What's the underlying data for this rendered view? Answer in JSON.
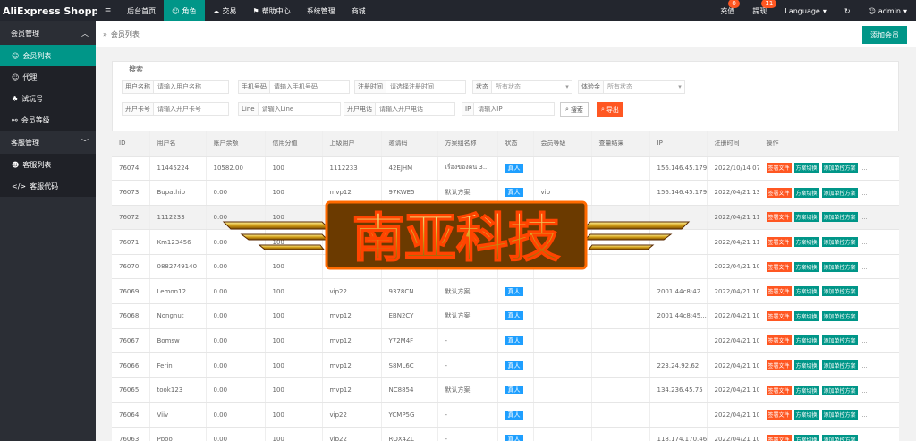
{
  "brand": "AliExpress Shopping...",
  "topnav": [
    {
      "label": "后台首页",
      "icon": "home"
    },
    {
      "label": "角色",
      "icon": "user"
    },
    {
      "label": "交易",
      "icon": "cloud"
    },
    {
      "label": "帮助中心",
      "icon": "flag"
    },
    {
      "label": "系统管理",
      "icon": ""
    },
    {
      "label": "商城",
      "icon": ""
    }
  ],
  "topright": {
    "recharge": "充值",
    "recharge_badge": "0",
    "withdraw": "提现",
    "withdraw_badge": "11",
    "language": "Language",
    "user": "admin"
  },
  "sidebar": {
    "groups": [
      {
        "label": "会员管理",
        "items": [
          {
            "label": "会员列表"
          },
          {
            "label": "代理"
          },
          {
            "label": "试玩号"
          },
          {
            "label": "会员等级"
          }
        ]
      },
      {
        "label": "客服管理",
        "items": [
          {
            "label": "客服列表"
          },
          {
            "label": "客服代码"
          }
        ]
      }
    ]
  },
  "breadcrumb": "会员列表",
  "add_button": "添加会员",
  "search": {
    "title": "搜索",
    "fields": [
      {
        "label": "用户名称",
        "placeholder": "请输入用户名称"
      },
      {
        "label": "手机号码",
        "placeholder": "请输入手机号码"
      },
      {
        "label": "注册时间",
        "placeholder": "请选择注册时间"
      },
      {
        "label": "状态",
        "value": "所有状态"
      },
      {
        "label": "体验金",
        "value": "所有状态"
      },
      {
        "label": "开户卡号",
        "placeholder": "请输入开户卡号"
      },
      {
        "label": "Line",
        "placeholder": "请输入Line"
      },
      {
        "label": "开户电话",
        "placeholder": "请输入开户电话"
      },
      {
        "label": "IP",
        "placeholder": "请输入IP"
      }
    ],
    "search_button": "搜索",
    "export_button": "导出"
  },
  "table": {
    "headers": [
      "ID",
      "用户名",
      "账户余额",
      "信用分值",
      "上级用户",
      "邀请码",
      "方案组名称",
      "状态",
      "会员等级",
      "查量结果",
      "IP",
      "注册时间",
      "操作"
    ],
    "rows": [
      [
        "76074",
        "11445224",
        "10582.00",
        "100",
        "1112233",
        "42EJHM",
        "เรื่องของคน 3...",
        "真人",
        "",
        "",
        "156.146.45.179",
        "2022/10/14 07:45"
      ],
      [
        "76073",
        "Bupathip",
        "0.00",
        "100",
        "mvp12",
        "97KWE5",
        "默认方案",
        "真人",
        "vip",
        "",
        "156.146.45.179",
        "2022/04/21 13:17"
      ],
      [
        "76072",
        "1112233",
        "0.00",
        "100",
        "",
        "",
        "",
        "",
        "",
        "",
        "",
        "2022/04/21 11:10"
      ],
      [
        "76071",
        "Km123456",
        "0.00",
        "100",
        "",
        "",
        "",
        "",
        "",
        "",
        "",
        "2022/04/21 11:01"
      ],
      [
        "76070",
        "0882749140",
        "0.00",
        "100",
        "vip22",
        "TOCKUV",
        "",
        "",
        "",
        "",
        "",
        "2022/04/21 10:58"
      ],
      [
        "76069",
        "Lemon12",
        "0.00",
        "100",
        "vip22",
        "9378CN",
        "默认方案",
        "真人",
        "",
        "",
        "2001:44c8:42...",
        "2022/04/21 10:53"
      ],
      [
        "76068",
        "Nongnut",
        "0.00",
        "100",
        "mvp12",
        "EBN2CY",
        "默认方案",
        "真人",
        "",
        "",
        "2001:44c8:45...",
        "2022/04/21 10:51"
      ],
      [
        "76067",
        "Bomsw",
        "0.00",
        "100",
        "mvp12",
        "Y72M4F",
        "-",
        "真人",
        "",
        "",
        "",
        "2022/04/21 10:49"
      ],
      [
        "76066",
        "Ferin",
        "0.00",
        "100",
        "mvp12",
        "S8ML6C",
        "-",
        "真人",
        "",
        "",
        "223.24.92.62",
        "2022/04/21 10:48"
      ],
      [
        "76065",
        "took123",
        "0.00",
        "100",
        "mvp12",
        "NC8854",
        "默认方案",
        "真人",
        "",
        "",
        "134.236.45.75",
        "2022/04/21 10:35"
      ],
      [
        "76064",
        "Viiv",
        "0.00",
        "100",
        "vip22",
        "YCMP5G",
        "-",
        "真人",
        "",
        "",
        "",
        "2022/04/21 10:18"
      ],
      [
        "76063",
        "Ppoo",
        "0.00",
        "100",
        "vip22",
        "RQX4ZL",
        "-",
        "真人",
        "",
        "",
        "118.174.170.46",
        "2022/04/21 10:18"
      ]
    ],
    "ops": [
      "签署文件",
      "方案切换",
      "添加单控方案",
      "..."
    ]
  },
  "watermark": "南亚科技",
  "colors": {
    "topbar": "#23262e",
    "sidebar": "#2b2e35",
    "accent": "#009688",
    "danger": "#ff5722",
    "tag": "#1e9fff"
  }
}
